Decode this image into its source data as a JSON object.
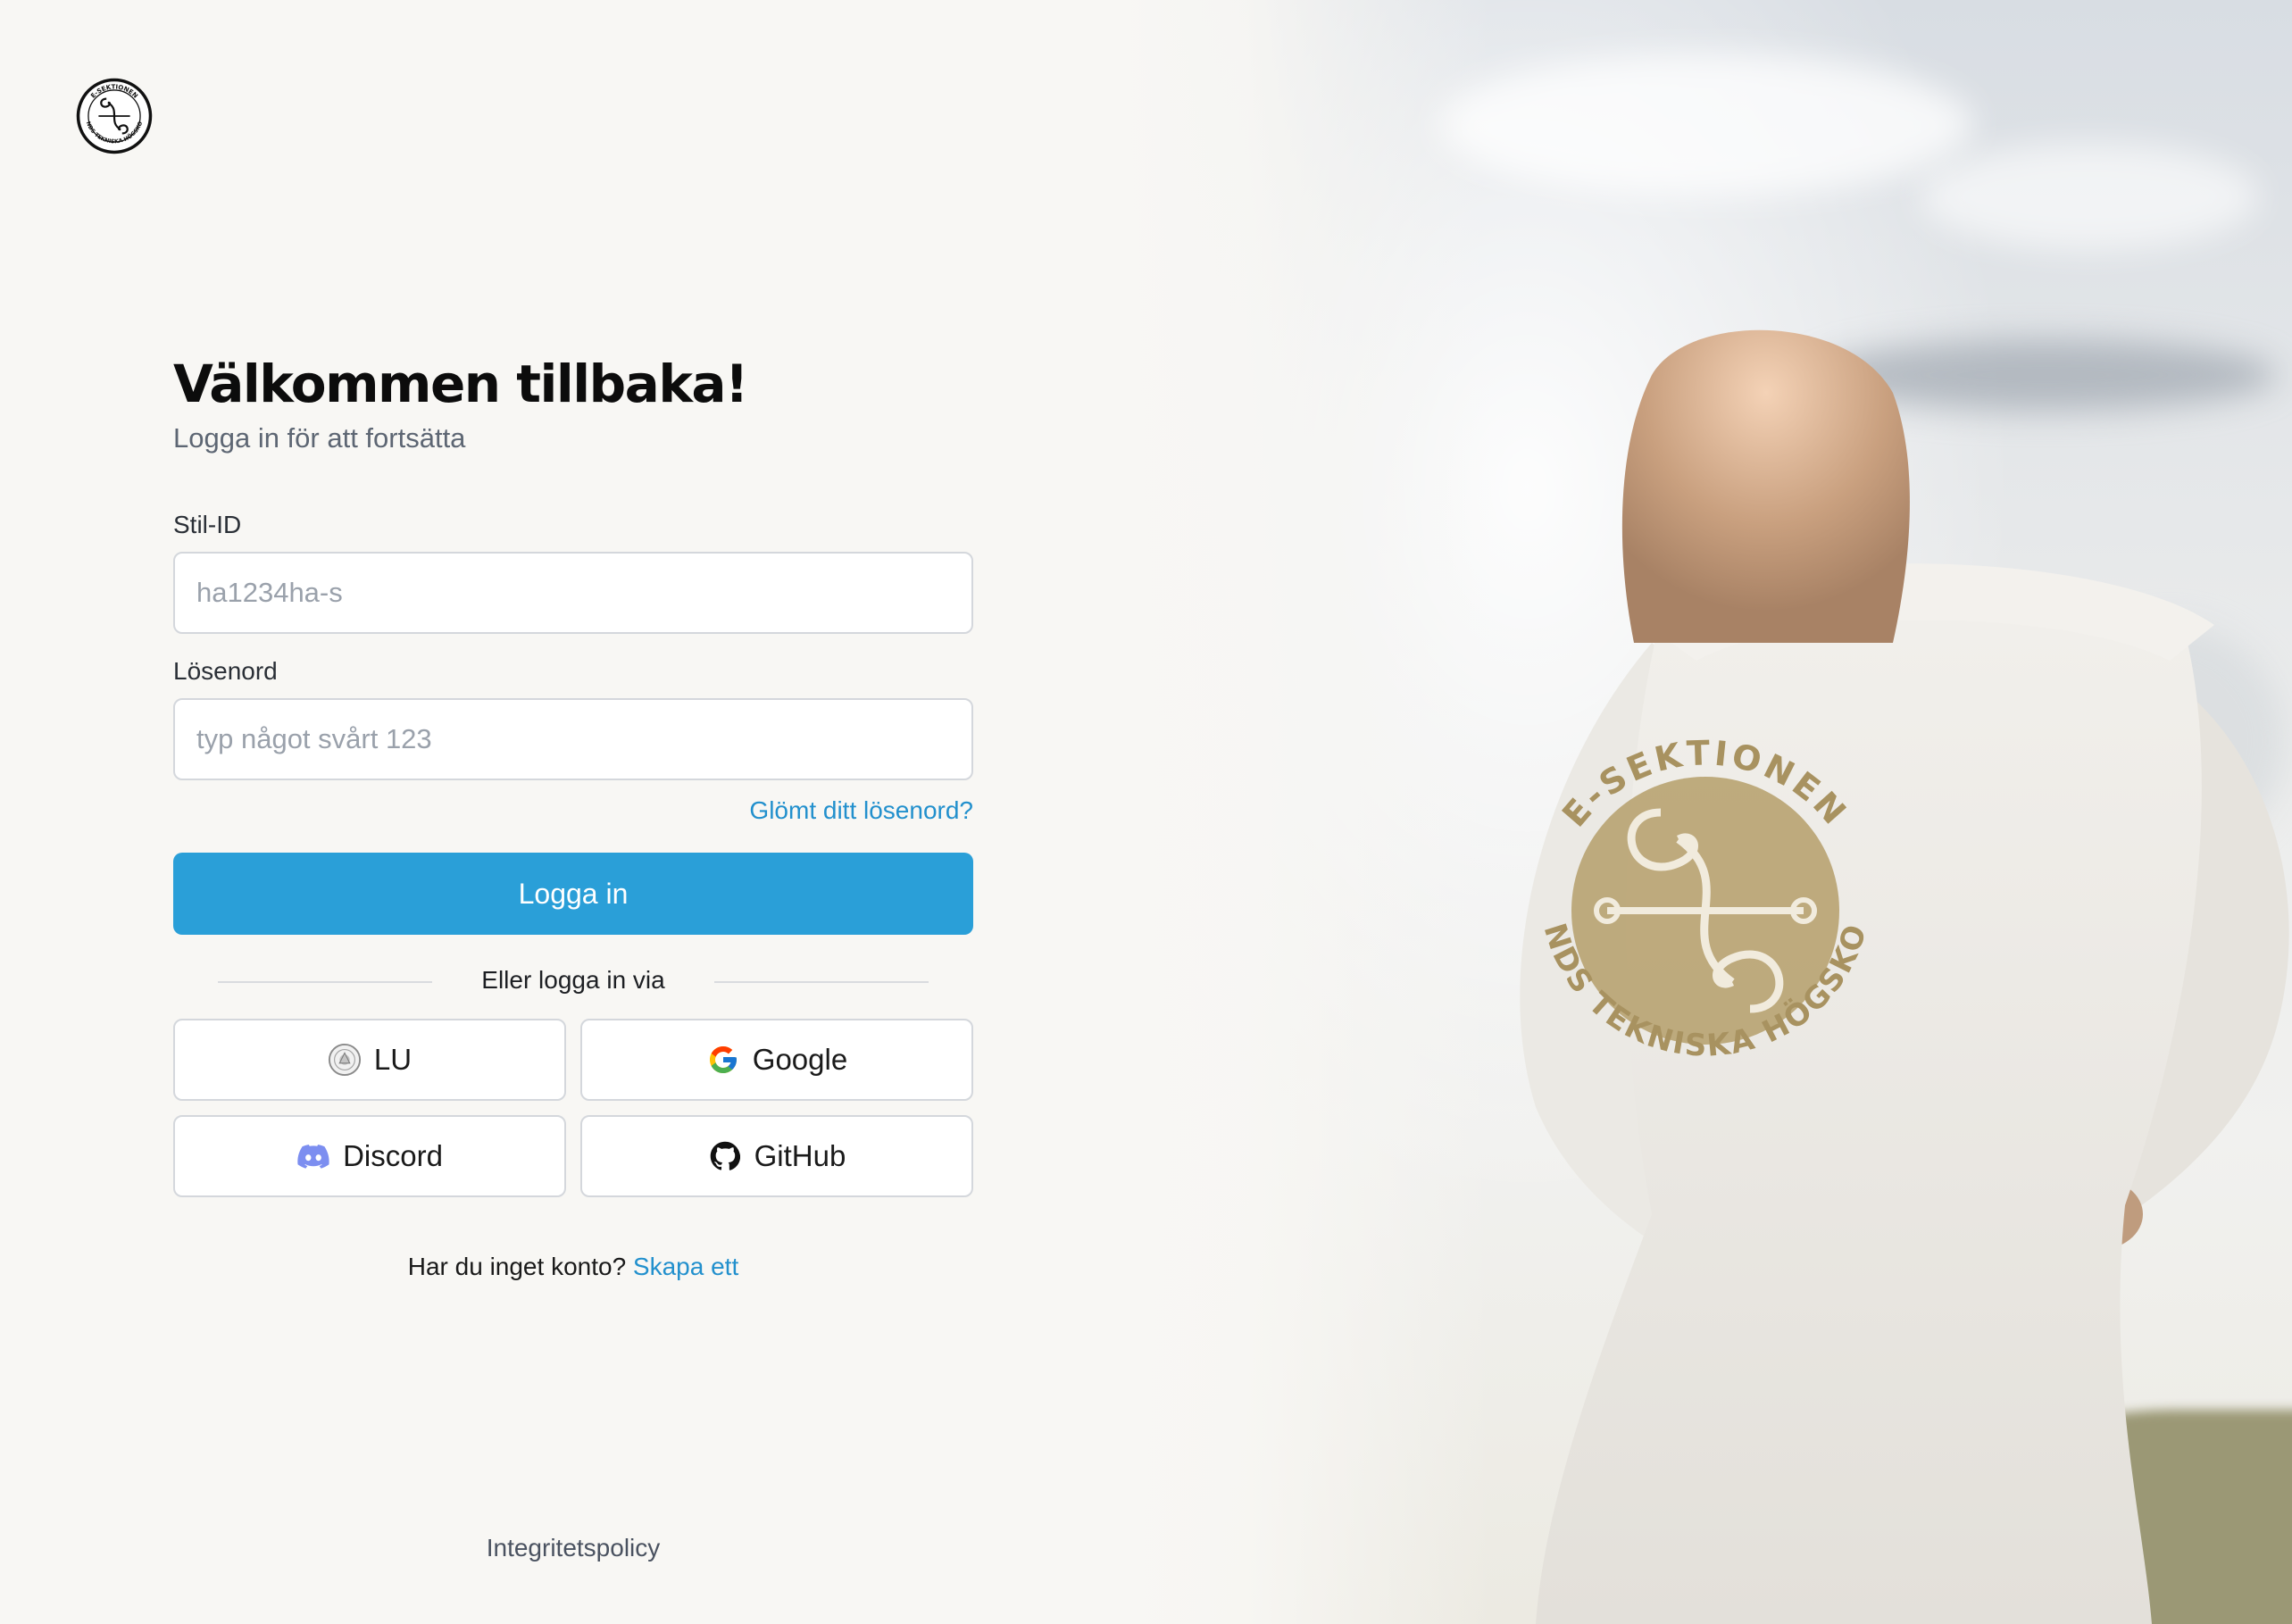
{
  "colors": {
    "accent": "#2a9fd8",
    "link": "#2290cd",
    "background": "#f8f7f4",
    "border": "#d4d7dc"
  },
  "logo": {
    "icon": "e-sektionen-seal-icon",
    "text": "E-SEKTIONEN LUNDS TEKNISKA HÖGSKOLA"
  },
  "login": {
    "title": "Välkommen tillbaka!",
    "subtitle": "Logga in för att fortsätta",
    "username": {
      "label": "Stil-ID",
      "placeholder": "ha1234ha-s",
      "value": ""
    },
    "password": {
      "label": "Lösenord",
      "placeholder": "typ något svårt 123",
      "value": ""
    },
    "forgot_label": "Glömt ditt lösenord?",
    "submit_label": "Logga in",
    "divider_label": "Eller logga in via",
    "providers": [
      {
        "label": "LU",
        "icon": "lu-seal-icon"
      },
      {
        "label": "Google",
        "icon": "google-icon"
      },
      {
        "label": "Discord",
        "icon": "discord-icon"
      },
      {
        "label": "GitHub",
        "icon": "github-icon"
      }
    ],
    "signup_prompt": "Har du inget konto?",
    "signup_link": "Skapa ett"
  },
  "footer": {
    "privacy_label": "Integritetspolicy"
  },
  "background_image": {
    "icon": "person-in-overalls-photo",
    "emblem_text_top": "E-SEKTIONEN",
    "emblem_text_bottom": "LUNDS TEKNISKA HÖGSKOLA"
  }
}
